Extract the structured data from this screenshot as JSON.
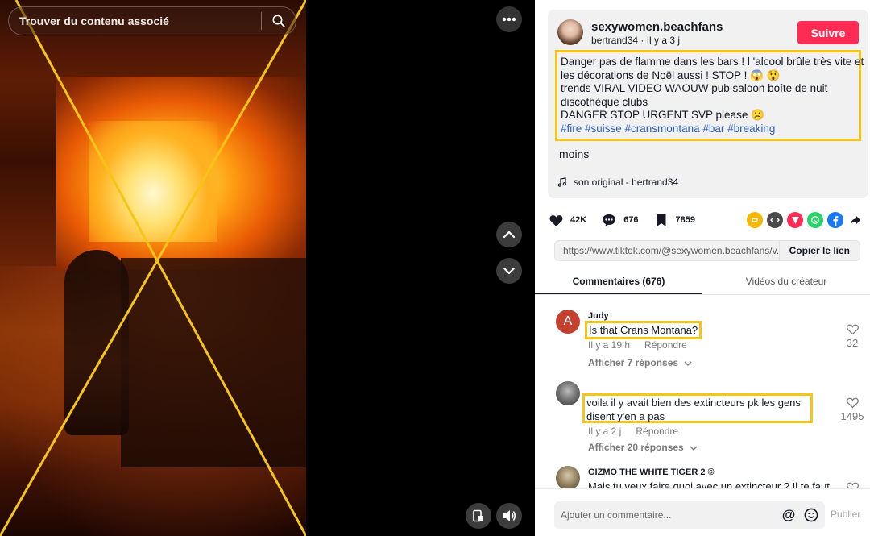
{
  "search": {
    "placeholder": "Trouver du contenu associé"
  },
  "icons": {
    "search": "search-icon",
    "more": "more-dots-icon",
    "up": "chevron-up-icon",
    "down": "chevron-down-icon",
    "pip": "picture-in-picture-icon",
    "volume": "volume-icon",
    "heart": "heart-icon",
    "comment": "comment-icon",
    "bookmark": "bookmark-icon",
    "music": "music-note-icon"
  },
  "colors": {
    "accent": "#fe2c55",
    "highlight": "#f5c518",
    "hashtag": "#2b5db9",
    "x_overlay": "#f5c518"
  },
  "post": {
    "username": "sexywomen.beachfans",
    "subline": "bertrand34 · Il y a 3 j",
    "follow_label": "Suivre",
    "description_lines": [
      "Danger pas de flamme dans les bars ! l 'alcool brûle très vite et",
      "les décorations de Noël aussi ! STOP ! 😱 😲",
      "trends VIRAL VIDEO WAOUW pub saloon boîte de nuit",
      "discothèque clubs",
      "DANGER STOP URGENT SVP please ☹️"
    ],
    "hashtags": "#fire #suisse #cransmontana #bar #breaking",
    "less_label": "moins",
    "sound": "son original - bertrand34"
  },
  "stats": {
    "likes": "42K",
    "comments": "676",
    "saves": "7859"
  },
  "share_buttons": [
    {
      "name": "repost-icon",
      "color": "#f5b700"
    },
    {
      "name": "embed-icon",
      "color": "#4a4a4a"
    },
    {
      "name": "send-icon",
      "color": "#fe2c55"
    },
    {
      "name": "whatsapp-icon",
      "color": "#25d366"
    },
    {
      "name": "facebook-icon",
      "color": "#1877f2"
    },
    {
      "name": "share-arrow-icon",
      "color": "#ffffff"
    }
  ],
  "link": {
    "url": "https://www.tiktok.com/@sexywomen.beachfans/v...",
    "copy_label": "Copier le lien"
  },
  "tabs": [
    {
      "label": "Commentaires (676)",
      "active": true
    },
    {
      "label": "Vidéos du créateur",
      "active": false
    }
  ],
  "comments": [
    {
      "name": "Judy",
      "avatar_letter": "A",
      "avatar_color": "#c4402f",
      "text_lines": [
        "Is that Crans Montana?"
      ],
      "time": "Il y a 19 h",
      "reply": "Répondre",
      "replies": "Afficher 7 réponses",
      "likes": "32"
    },
    {
      "name": "",
      "avatar_letter": "",
      "avatar_color": "#6a6a6a",
      "text_lines": [
        "voila il y avait bien des extincteurs pk les gens",
        "disent y'en a pas"
      ],
      "time": "Il y a 2 j",
      "reply": "Répondre",
      "replies": "Afficher 20 réponses",
      "likes": "1495"
    },
    {
      "name": "GIZMO THE WHITE TIGER 2 ©",
      "avatar_letter": "",
      "avatar_color": "#8a7a5a",
      "text_lines": [
        "Mais tu veux faire quoi avec un extincteur ? Il te faut"
      ],
      "time": "",
      "reply": "",
      "replies": "",
      "likes": ""
    }
  ],
  "composer": {
    "placeholder": "Ajouter un commentaire...",
    "at_label": "@",
    "publish_label": "Publier"
  }
}
